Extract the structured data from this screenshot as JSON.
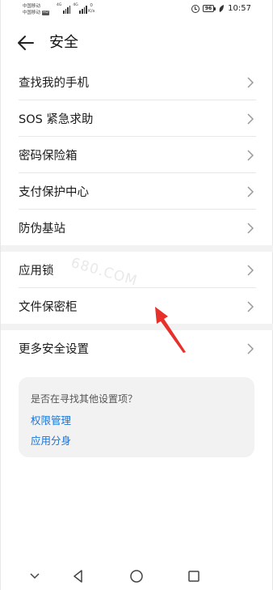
{
  "status_bar": {
    "carrier_1": "中国移动",
    "carrier_2": "中国移动",
    "hd": "HD",
    "net_1": "4G",
    "net_2": "4G",
    "speed_value": "0",
    "speed_unit": "K/s",
    "battery": "96",
    "time": "10:57"
  },
  "header": {
    "title": "安全",
    "back_icon": "arrow-left-icon"
  },
  "sections": [
    {
      "items": [
        {
          "label": "查找我的手机"
        },
        {
          "label": "SOS 紧急求助"
        },
        {
          "label": "密码保险箱"
        },
        {
          "label": "支付保护中心"
        },
        {
          "label": "防伪基站"
        }
      ]
    },
    {
      "items": [
        {
          "label": "应用锁"
        },
        {
          "label": "文件保密柜"
        }
      ]
    },
    {
      "items": [
        {
          "label": "更多安全设置"
        }
      ]
    }
  ],
  "suggestion_card": {
    "title": "是否在寻找其他设置项？",
    "links": [
      "权限管理",
      "应用分身"
    ]
  },
  "watermark": "680.COM",
  "annotation": {
    "color": "#e8302a",
    "shape": "arrow-pointing-up-left"
  },
  "nav_bar": {
    "icons": [
      "chevron-down-icon",
      "back-triangle-icon",
      "home-circle-icon",
      "recents-square-icon"
    ]
  },
  "colors": {
    "accent_link": "#1b73d6",
    "band": "#f2f2f2",
    "divider": "#e7e7e7"
  }
}
